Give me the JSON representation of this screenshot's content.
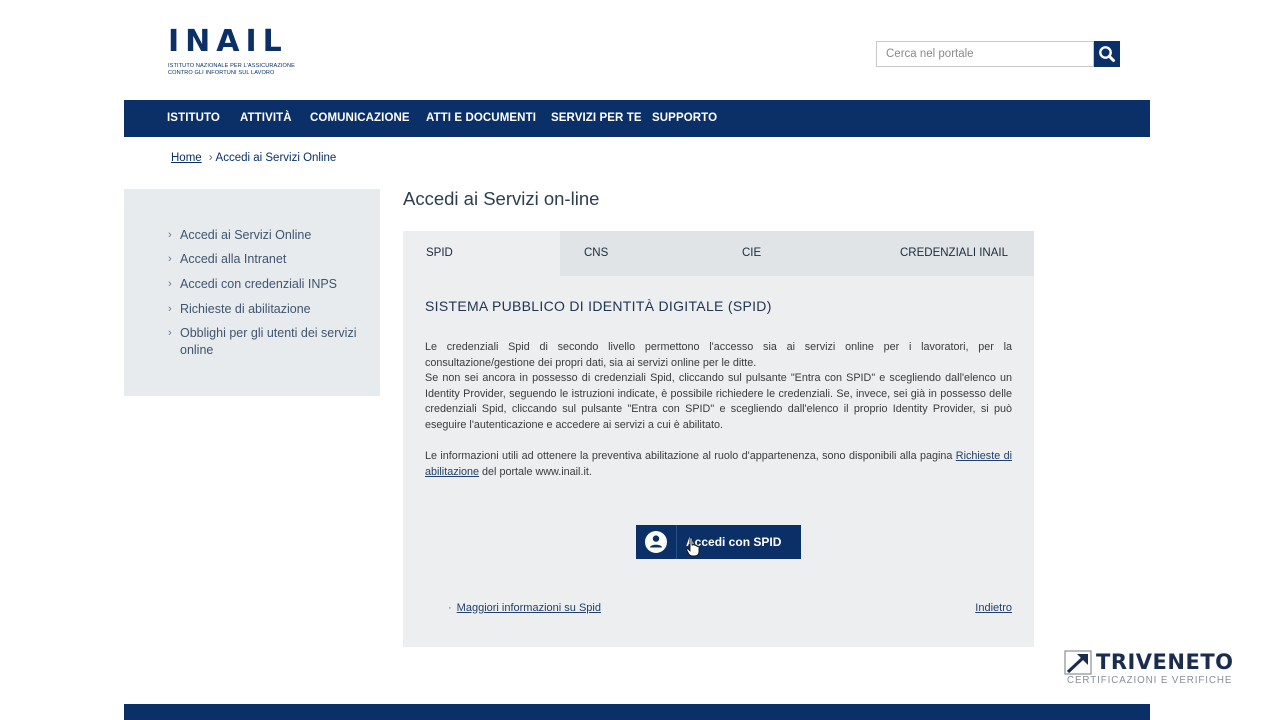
{
  "header": {
    "logo_text": "INAIL",
    "logo_subtitle_line1": "ISTITUTO NAZIONALE PER L'ASSICURAZIONE",
    "logo_subtitle_line2": "CONTRO GLI INFORTUNI SUL LAVORO",
    "search_placeholder": "Cerca nel portale",
    "search_icon": "search-icon"
  },
  "nav": {
    "items": [
      "ISTITUTO",
      "ATTIVITÀ",
      "COMUNICAZIONE",
      "ATTI E DOCUMENTI",
      "SERVIZI PER TE",
      "SUPPORTO"
    ]
  },
  "breadcrumb": {
    "home": "Home",
    "separator": "›",
    "current": "Accedi ai Servizi Online"
  },
  "sidebar": {
    "chevron": "›",
    "items": [
      "Accedi ai Servizi Online",
      "Accedi alla Intranet",
      "Accedi con credenziali INPS",
      "Richieste di abilitazione",
      "Obblighi per gli utenti dei servizi online"
    ]
  },
  "main": {
    "title": "Accedi ai Servizi on-line",
    "tabs": [
      "SPID",
      "CNS",
      "CIE",
      "CREDENZIALI INAIL"
    ],
    "active_tab": "SPID",
    "panel": {
      "title": "SISTEMA PUBBLICO DI IDENTITÀ DIGITALE (SPID)",
      "para1": "Le credenziali Spid di secondo livello permettono l'accesso sia ai servizi online per i lavoratori, per la consultazione/gestione dei propri dati, sia ai servizi online per le ditte.",
      "para2": "Se non sei ancora in possesso di credenziali Spid, cliccando sul pulsante \"Entra con SPID\" e scegliendo dall'elenco un Identity Provider, seguendo le istruzioni indicate, è possibile richiedere le credenziali. Se, invece, sei già in possesso delle credenziali Spid, cliccando sul pulsante \"Entra con SPID\" e scegliendo dall'elenco il proprio Identity Provider, si può eseguire l'autenticazione e accedere ai servizi a cui è abilitato.",
      "para3_before": "Le informazioni utili ad ottenere la preventiva abilitazione al ruolo d'appartenenza, sono disponibili alla pagina ",
      "para3_link": "Richieste di abilitazione",
      "para3_after": " del portale www.inail.it.",
      "spid_button_label": "Accedi con SPID",
      "more_dot": "·",
      "more_info_link": "Maggiori informazioni su Spid",
      "back_link": "Indietro"
    }
  },
  "watermark": {
    "brand": "TRIVENETO",
    "subtitle": "CERTIFICAZIONI E VERIFICHE"
  },
  "colors": {
    "brand_navy": "#0b3068",
    "sidebar_bg": "#e7ebee",
    "panel_bg": "#eceef0",
    "tab_bar_bg": "#e1e4e7"
  }
}
